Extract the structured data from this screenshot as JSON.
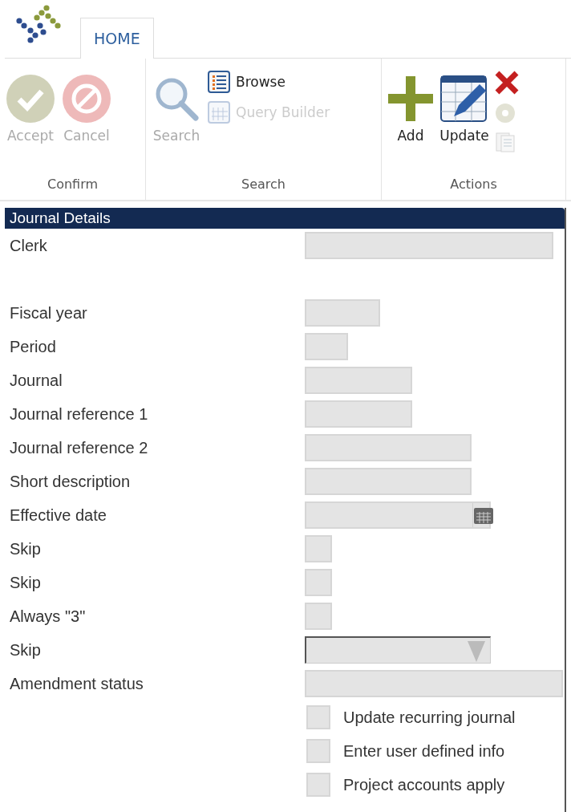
{
  "tabs": [
    {
      "label": "HOME",
      "selected": true
    }
  ],
  "ribbon": {
    "groups": [
      {
        "label": "Confirm",
        "items": [
          {
            "kind": "accept",
            "label": "Accept",
            "disabled": true
          },
          {
            "kind": "cancel",
            "label": "Cancel",
            "disabled": true
          }
        ]
      },
      {
        "label": "Search",
        "items": [
          {
            "kind": "search",
            "label": "Search",
            "disabled": true
          },
          {
            "kind": "browse",
            "label": "Browse",
            "disabled": false
          },
          {
            "kind": "query",
            "label": "Query Builder",
            "disabled": true
          }
        ]
      },
      {
        "label": "Actions",
        "items": [
          {
            "kind": "add",
            "label": "Add",
            "disabled": false
          },
          {
            "kind": "update",
            "label": "Update",
            "disabled": false
          },
          {
            "kind": "delete",
            "disabled": false
          },
          {
            "kind": "disc",
            "disabled": true
          },
          {
            "kind": "doc",
            "disabled": true
          }
        ]
      }
    ]
  },
  "panel": {
    "title": "Journal Details",
    "fields": [
      {
        "kind": "text",
        "label": "Clerk"
      },
      {
        "kind": "gap"
      },
      {
        "kind": "text",
        "label": "Fiscal year"
      },
      {
        "kind": "text",
        "label": "Period"
      },
      {
        "kind": "text",
        "label": "Journal"
      },
      {
        "kind": "text",
        "label": "Journal reference 1"
      },
      {
        "kind": "text",
        "label": "Journal reference 2"
      },
      {
        "kind": "text",
        "label": "Short description"
      },
      {
        "kind": "date",
        "label": "Effective date"
      },
      {
        "kind": "text",
        "label": "Skip"
      },
      {
        "kind": "text",
        "label": "Skip"
      },
      {
        "kind": "text",
        "label": "Always \"3\""
      },
      {
        "kind": "select",
        "label": "Skip"
      },
      {
        "kind": "text",
        "label": "Amendment status"
      },
      {
        "kind": "checkbox",
        "label": "Update recurring journal",
        "checked": false
      },
      {
        "kind": "checkbox",
        "label": "Enter user defined info",
        "checked": false
      },
      {
        "kind": "checkbox",
        "label": "Project accounts apply",
        "checked": false
      }
    ]
  }
}
